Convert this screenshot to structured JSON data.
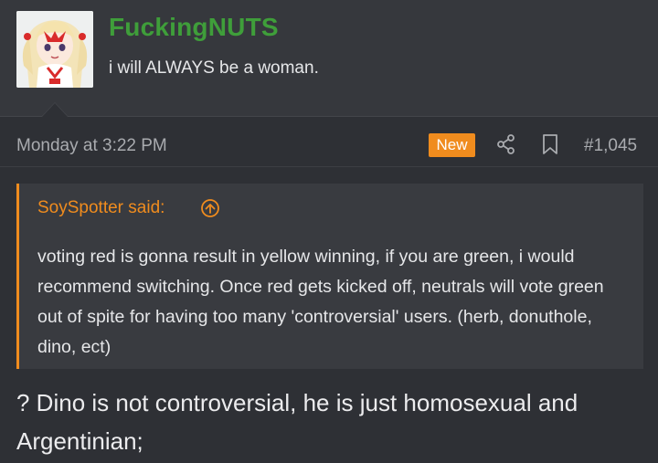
{
  "user": {
    "name": "FuckingNUTS",
    "title": "i will ALWAYS be a woman."
  },
  "meta": {
    "date": "Monday at 3:22 PM",
    "badge": "New",
    "post_number": "#1,045",
    "icons": [
      "share-icon",
      "bookmark-icon"
    ]
  },
  "quote": {
    "attribution": "SoySpotter said:",
    "body": "voting red is gonna result in yellow winning, if you are green, i would recommend switching. Once red gets kicked off, neutrals will vote green out of spite for having too many 'controversial' users. (herb, donuthole, dino, ect)"
  },
  "post": {
    "text": "? Dino is not controversial, he is just homosexual and Argentinian;"
  },
  "colors": {
    "username": "#3f9e3a",
    "accent": "#f08c1e",
    "background": "#2e3035",
    "header_bg": "#36383d",
    "quote_bg": "#393b40"
  }
}
